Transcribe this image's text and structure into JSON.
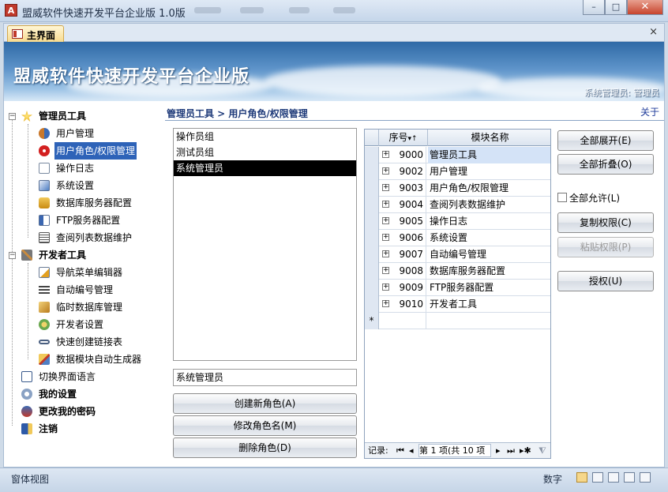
{
  "window": {
    "app_icon": "A",
    "title": "盟威软件快速开发平台企业版 1.0版",
    "min_label": "–",
    "max_label": "□",
    "close_label": "✕"
  },
  "tab": {
    "label": "主界面",
    "close_label": "×"
  },
  "banner": {
    "title": "盟威软件快速开发平台企业版",
    "admin_label": "系统管理员: 管理员"
  },
  "breadcrumb": "管理员工具 > 用户角色/权限管理",
  "about_label": "关于",
  "tree": {
    "admin_tools": "管理员工具",
    "admin_items": [
      "用户管理",
      "用户角色/权限管理",
      "操作日志",
      "系统设置",
      "数据库服务器配置",
      "FTP服务器配置",
      "查阅列表数据维护"
    ],
    "dev_tools": "开发者工具",
    "dev_items": [
      "导航菜单编辑器",
      "自动编号管理",
      "临时数据库管理",
      "开发者设置",
      "快速创建链接表",
      "数据模块自动生成器"
    ],
    "bottom_items": [
      "切换界面语言",
      "我的设置",
      "更改我的密码",
      "注销"
    ]
  },
  "roles": {
    "items": [
      "操作员组",
      "测试员组",
      "系统管理员"
    ],
    "selected_index": 2,
    "current_name": "系统管理员"
  },
  "role_buttons": {
    "create": "创建新角色(A)",
    "rename": "修改角色名(M)",
    "delete": "删除角色(D)"
  },
  "grid": {
    "col_id": "序号",
    "sort_glyph": "▾↑",
    "col_name": "模块名称",
    "new_row_marker": "*",
    "expand_glyph": "+",
    "rows": [
      {
        "id": "9000",
        "name": "管理员工具"
      },
      {
        "id": "9002",
        "name": "用户管理"
      },
      {
        "id": "9003",
        "name": "用户角色/权限管理"
      },
      {
        "id": "9004",
        "name": "查阅列表数据维护"
      },
      {
        "id": "9005",
        "name": "操作日志"
      },
      {
        "id": "9006",
        "name": "系统设置"
      },
      {
        "id": "9007",
        "name": "自动编号管理"
      },
      {
        "id": "9008",
        "name": "数据库服务器配置"
      },
      {
        "id": "9009",
        "name": "FTP服务器配置"
      },
      {
        "id": "9010",
        "name": "开发者工具"
      }
    ],
    "nav": {
      "label": "记录:",
      "first": "⏮",
      "prev": "◂",
      "position": "第 1 项(共 10 项",
      "next": "▸",
      "last": "⏭",
      "new": "▸✱"
    }
  },
  "actions": {
    "expand_all": "全部展开(E)",
    "collapse_all": "全部折叠(O)",
    "allow_all": "全部允许(L)",
    "copy_perm": "复制权限(C)",
    "paste_perm": "粘贴权限(P)",
    "grant": "授权(U)"
  },
  "status": {
    "left": "窗体视图",
    "num": "数字"
  },
  "colors": {
    "accent": "#2e63b8",
    "banner_top": "#2f6aa6",
    "breadcrumb": "#1f3b7a"
  }
}
